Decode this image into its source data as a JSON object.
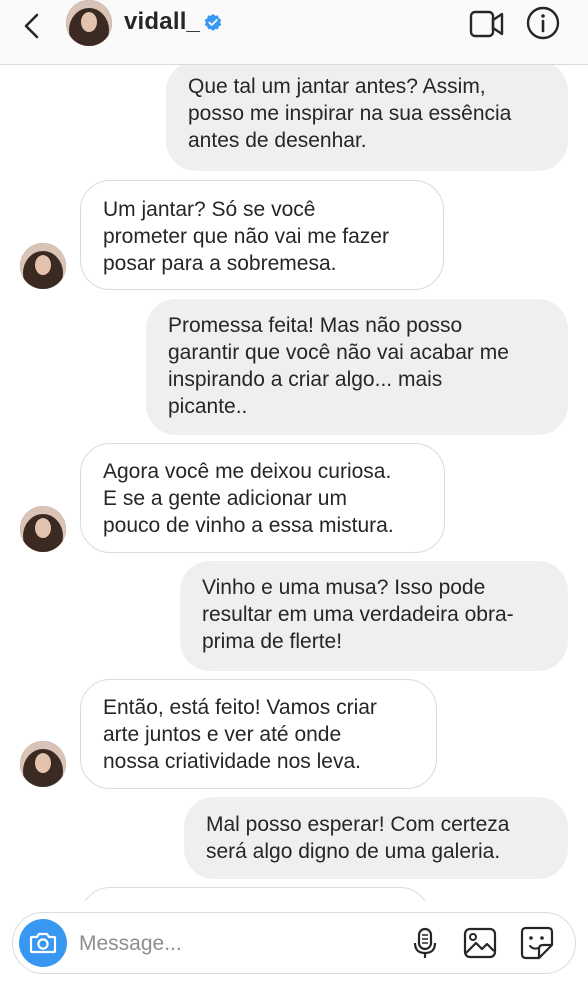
{
  "header": {
    "username": "vidall_",
    "verified": true,
    "icons": [
      "back-chevron-icon",
      "video-call-icon",
      "info-icon"
    ]
  },
  "messages": [
    {
      "side": "sent",
      "text": "Que tal um jantar antes? Assim,\nposso me inspirar na sua essência\nantes de desenhar."
    },
    {
      "side": "received",
      "text": "Um jantar? Só se você\nprometer que não vai me fazer\nposar para a sobremesa."
    },
    {
      "side": "sent",
      "text": "Promessa feita! Mas não posso\ngarantir que você não vai acabar me\ninspirando a criar algo... mais\npicante.."
    },
    {
      "side": "received",
      "text": "Agora você me deixou curiosa.\nE se a gente adicionar um\npouco de vinho a essa mistura."
    },
    {
      "side": "sent",
      "text": "Vinho e uma musa? Isso pode\nresultar em uma verdadeira obra-\nprima de flerte!"
    },
    {
      "side": "received",
      "text": " Então, está feito! Vamos criar\narte juntos e ver até onde\nnossa criatividade nos leva."
    },
    {
      "side": "sent",
      "text": "Mal posso esperar! Com certeza\nserá algo digno de uma galeria."
    }
  ],
  "composer": {
    "placeholder": "Message...",
    "icons": [
      "camera-icon",
      "microphone-icon",
      "gallery-icon",
      "sticker-icon"
    ]
  },
  "colors": {
    "sent_bubble": "#efefef",
    "received_border": "#dbdbdb",
    "verified_blue": "#3897f0",
    "camera_blue": "#3897f0"
  }
}
